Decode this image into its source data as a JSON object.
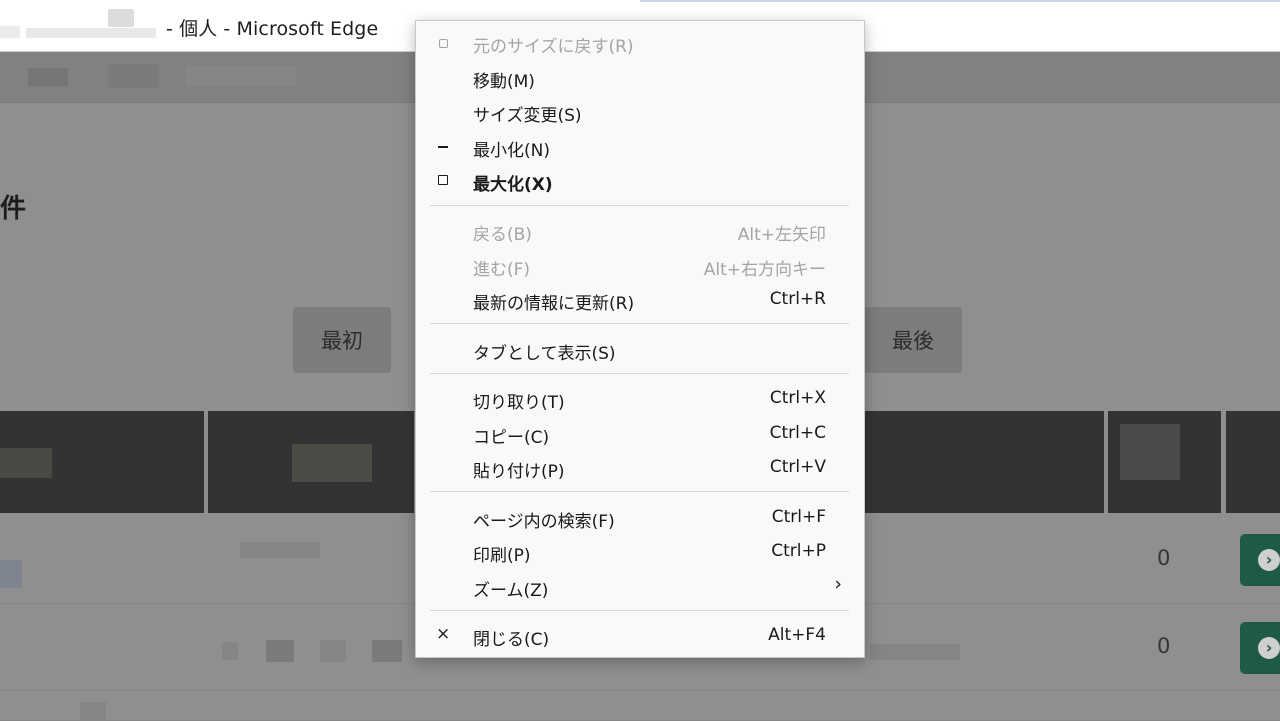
{
  "titlebar": {
    "title": "- 個人 - Microsoft Edge"
  },
  "page": {
    "heading_fragment": "件",
    "pager": {
      "first": "最初",
      "last": "最後"
    },
    "rows": [
      {
        "value": "0"
      },
      {
        "value": "0"
      }
    ]
  },
  "menu": {
    "groups": {
      "window": [
        {
          "icon": "restore-icon",
          "label": "元のサイズに戻す(R)",
          "disabled": true
        },
        {
          "label": "移動(M)"
        },
        {
          "label": "サイズ変更(S)"
        },
        {
          "icon": "minimize-icon",
          "label": "最小化(N)"
        },
        {
          "icon": "maximize-icon",
          "label": "最大化(X)",
          "bold": true
        }
      ],
      "nav": [
        {
          "label": "戻る(B)",
          "shortcut": "Alt+左矢印",
          "disabled": true
        },
        {
          "label": "進む(F)",
          "shortcut": "Alt+右方向キー",
          "disabled": true
        },
        {
          "label": "最新の情報に更新(R)",
          "shortcut": "Ctrl+R"
        }
      ],
      "tab": [
        {
          "label": "タブとして表示(S)"
        }
      ],
      "edit": [
        {
          "label": "切り取り(T)",
          "shortcut": "Ctrl+X"
        },
        {
          "label": "コピー(C)",
          "shortcut": "Ctrl+C"
        },
        {
          "label": "貼り付け(P)",
          "shortcut": "Ctrl+V"
        }
      ],
      "tools": [
        {
          "label": "ページ内の検索(F)",
          "shortcut": "Ctrl+F"
        },
        {
          "label": "印刷(P)",
          "shortcut": "Ctrl+P"
        },
        {
          "label": "ズーム(Z)",
          "submenu_glyph": "›"
        }
      ],
      "close": [
        {
          "icon": "close-icon",
          "glyph": "×",
          "label": "閉じる(C)",
          "shortcut": "Alt+F4"
        }
      ]
    }
  }
}
